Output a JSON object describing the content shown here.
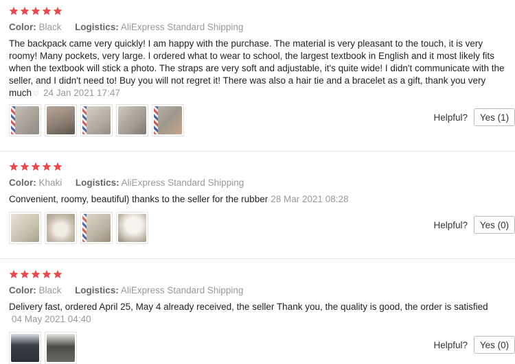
{
  "labels": {
    "color": "Color:",
    "logistics": "Logistics:",
    "helpful": "Helpful?"
  },
  "star_color": "#f04848",
  "reviews": [
    {
      "stars": 5,
      "color": "Black",
      "logistics": "AliExpress Standard Shipping",
      "text": "The backpack came very quickly! I am happy with the purchase. The material is very pleasant to the touch, it is very roomy! Many pockets, very large. I ordered what to wear to school, the largest textbook in English and it most likely fits when the textbook will stick a photo. The straps are very soft and adjustable, it's quite wide! I didn't communicate with the seller, and I didn't need to! Buy you will not regret it! There was also a hair tie and a bracelet as a gift, thank you very much",
      "date": "24 Jan 2021 17:47",
      "photo_count": 5,
      "helpful_button": "Yes (1)"
    },
    {
      "stars": 5,
      "color": "Khaki",
      "logistics": "AliExpress Standard Shipping",
      "text": "Convenient, roomy, beautiful) thanks to the seller for the rubber",
      "date": "28 Mar 2021 08:28",
      "photo_count": 4,
      "helpful_button": "Yes (0)"
    },
    {
      "stars": 5,
      "color": "Black",
      "logistics": "AliExpress Standard Shipping",
      "text": "Delivery fast, ordered April 25, May 4 already received, the seller Thank you, the quality is good, the order is satisfied",
      "date": "04 May 2021 04:40",
      "photo_count": 2,
      "helpful_button": "Yes (0)"
    }
  ]
}
